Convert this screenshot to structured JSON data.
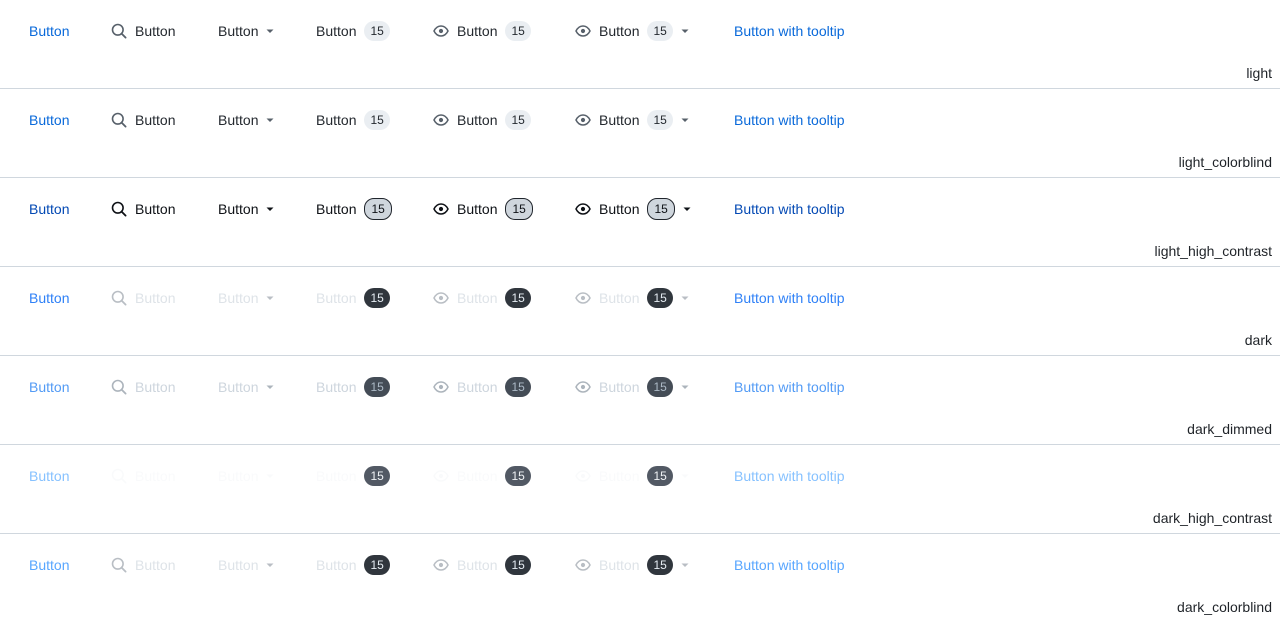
{
  "buttons": {
    "plain": "Button",
    "search": "Button",
    "dropdown": "Button",
    "counter": "Button",
    "eye_counter": "Button",
    "eye_counter_dropdown": "Button",
    "tooltip": "Button with tooltip"
  },
  "counter_value": "15",
  "icons": {
    "search": "search-icon",
    "eye": "eye-icon",
    "caret": "triangle-down-icon"
  },
  "themes": [
    {
      "name": "light",
      "link": "#0969da",
      "text": "#24292f",
      "icon": "#57606a",
      "badge_bg": "#eaeef2",
      "badge_fg": "#24292f",
      "badge_border": "none",
      "link_opacity": 1,
      "text_opacity": 1
    },
    {
      "name": "light_colorblind",
      "link": "#0969da",
      "text": "#24292f",
      "icon": "#57606a",
      "badge_bg": "#eaeef2",
      "badge_fg": "#24292f",
      "badge_border": "none",
      "link_opacity": 1,
      "text_opacity": 1
    },
    {
      "name": "light_high_contrast",
      "link": "#0349b4",
      "text": "#0e1116",
      "icon": "#0e1116",
      "badge_bg": "#cfd6dd",
      "badge_fg": "#0e1116",
      "badge_border": "1px solid #20252c",
      "link_opacity": 1,
      "text_opacity": 1
    },
    {
      "name": "dark",
      "link": "#2f81f7",
      "text": "#c9d1d9",
      "icon": "#8b949e",
      "badge_bg": "#30363d",
      "badge_fg": "#e6edf3",
      "badge_border": "none",
      "link_opacity": 1,
      "text_opacity": 1
    },
    {
      "name": "dark_dimmed",
      "link": "#539bf5",
      "text": "#adbac7",
      "icon": "#768390",
      "badge_bg": "#444c56",
      "badge_fg": "#adbac7",
      "badge_border": "none",
      "link_opacity": 1,
      "text_opacity": 1
    },
    {
      "name": "dark_high_contrast",
      "link": "#71b7ff",
      "text": "#f0f3f6",
      "icon": "#f0f3f6",
      "badge_bg": "#525964",
      "badge_fg": "#f0f3f6",
      "badge_border": "none",
      "link_opacity": 1,
      "text_opacity": 1
    },
    {
      "name": "dark_colorblind",
      "link": "#58a6ff",
      "text": "#c9d1d9",
      "icon": "#8b949e",
      "badge_bg": "#30363d",
      "badge_fg": "#e6edf3",
      "badge_border": "none",
      "link_opacity": 1,
      "text_opacity": 1
    }
  ]
}
